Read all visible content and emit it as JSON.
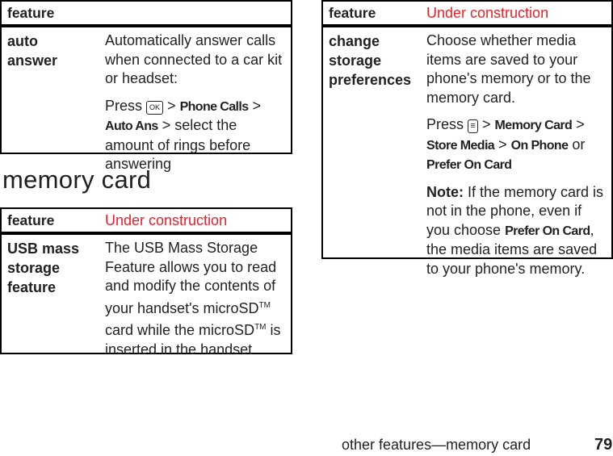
{
  "table_auto_answer": {
    "header": {
      "feature": "feature",
      "note": ""
    },
    "row": {
      "name": "auto answer",
      "desc": "Automatically answer calls when connected to a car kit or headset:",
      "press": "Press",
      "key_icon": "ok-key-icon",
      "key_label": "OK",
      "sep1": " > ",
      "menu1": "Phone Calls",
      "sep2": " > ",
      "menu2": "Auto Ans",
      "tail": " > select the amount of rings before answering"
    }
  },
  "section_title": "memory card",
  "table_usb": {
    "header": {
      "feature": "feature",
      "note": "Under construction"
    },
    "row": {
      "name": "USB mass storage feature",
      "desc_a": "The USB Mass Storage Feature allows you to read and modify the contents of your handset's microSD",
      "tm1": "TM",
      "desc_b": " card while the microSD",
      "tm2": "TM",
      "desc_c": " is inserted in the handset"
    }
  },
  "table_storage": {
    "header": {
      "feature": "feature",
      "note": "Under construction"
    },
    "row": {
      "name": "change storage preferences",
      "desc": "Choose whether media items are saved to your phone's memory or to the memory card.",
      "press": "Press",
      "key_icon": "menu-key-icon",
      "key_label": "≡",
      "sep1": " > ",
      "menu1": "Memory Card",
      "sep2": " > ",
      "menu2": "Store Media",
      "sep3": " > ",
      "menu3": "On Phone",
      "or": " or ",
      "menu4": "Prefer On Card",
      "note_label": "Note:",
      "note_a": " If the memory card is not in the phone, even if you choose ",
      "note_menu": "Prefer On Card",
      "note_b": ", the media items are saved to your phone's memory."
    }
  },
  "footer": {
    "text": "other features—memory card",
    "page": "79"
  },
  "colors": {
    "accent": "#e8202a",
    "text": "#231f20"
  }
}
